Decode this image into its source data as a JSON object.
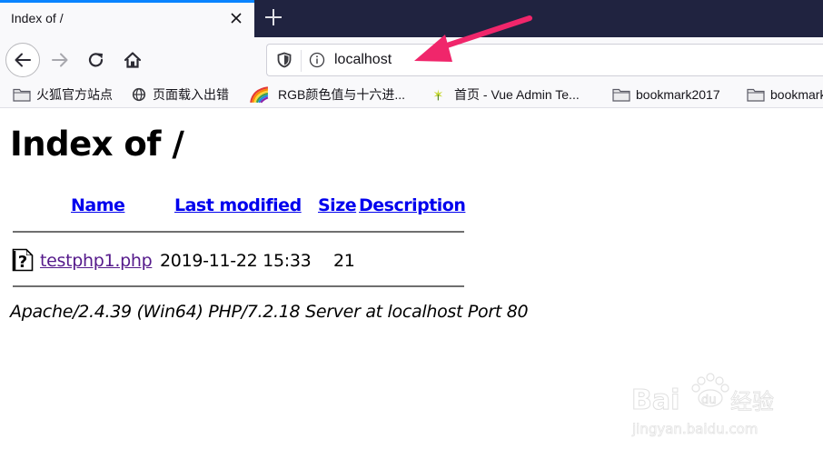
{
  "browser": {
    "tab": {
      "title": "Index of /",
      "close_icon": "close-icon"
    },
    "new_tab_icon": "plus-icon",
    "nav": {
      "back_icon": "arrow-left-icon",
      "forward_icon": "arrow-right-icon",
      "reload_icon": "reload-icon",
      "home_icon": "home-icon"
    },
    "urlbar": {
      "shield_icon": "tracking-protection-shield-icon",
      "info_icon": "info-icon",
      "url": "localhost"
    },
    "bookmarks": [
      {
        "label": "火狐官方站点",
        "icon": "folder-icon"
      },
      {
        "label": "页面载入出错",
        "icon": "globe-icon"
      },
      {
        "label": "RGB颜色值与十六进...",
        "icon": "rainbow-icon"
      },
      {
        "label": "首页 - Vue Admin Te...",
        "icon": "sparkle-icon"
      },
      {
        "label": "bookmark2017",
        "icon": "folder-icon"
      },
      {
        "label": "bookmark",
        "icon": "folder-icon"
      }
    ]
  },
  "annotation": {
    "arrow_color": "#f0266b"
  },
  "page": {
    "title": "Index of /",
    "columns": [
      "Name",
      "Last modified",
      "Size",
      "Description"
    ],
    "rows": [
      {
        "icon": "unknown-file-icon",
        "name": "testphp1.php",
        "last_modified": "2019-11-22 15:33",
        "size": "21",
        "description": ""
      }
    ],
    "address": "Apache/2.4.39 (Win64) PHP/7.2.18 Server at localhost Port 80"
  },
  "watermark": {
    "brand": "Bai",
    "brand2": "du",
    "cn": "经验",
    "domain": "jingyan.baidu.com"
  },
  "colors": {
    "link": "#0000ee",
    "visited_link": "#551a8b",
    "tab_accent": "#0a84ff",
    "tabstrip_bg": "#202340"
  }
}
